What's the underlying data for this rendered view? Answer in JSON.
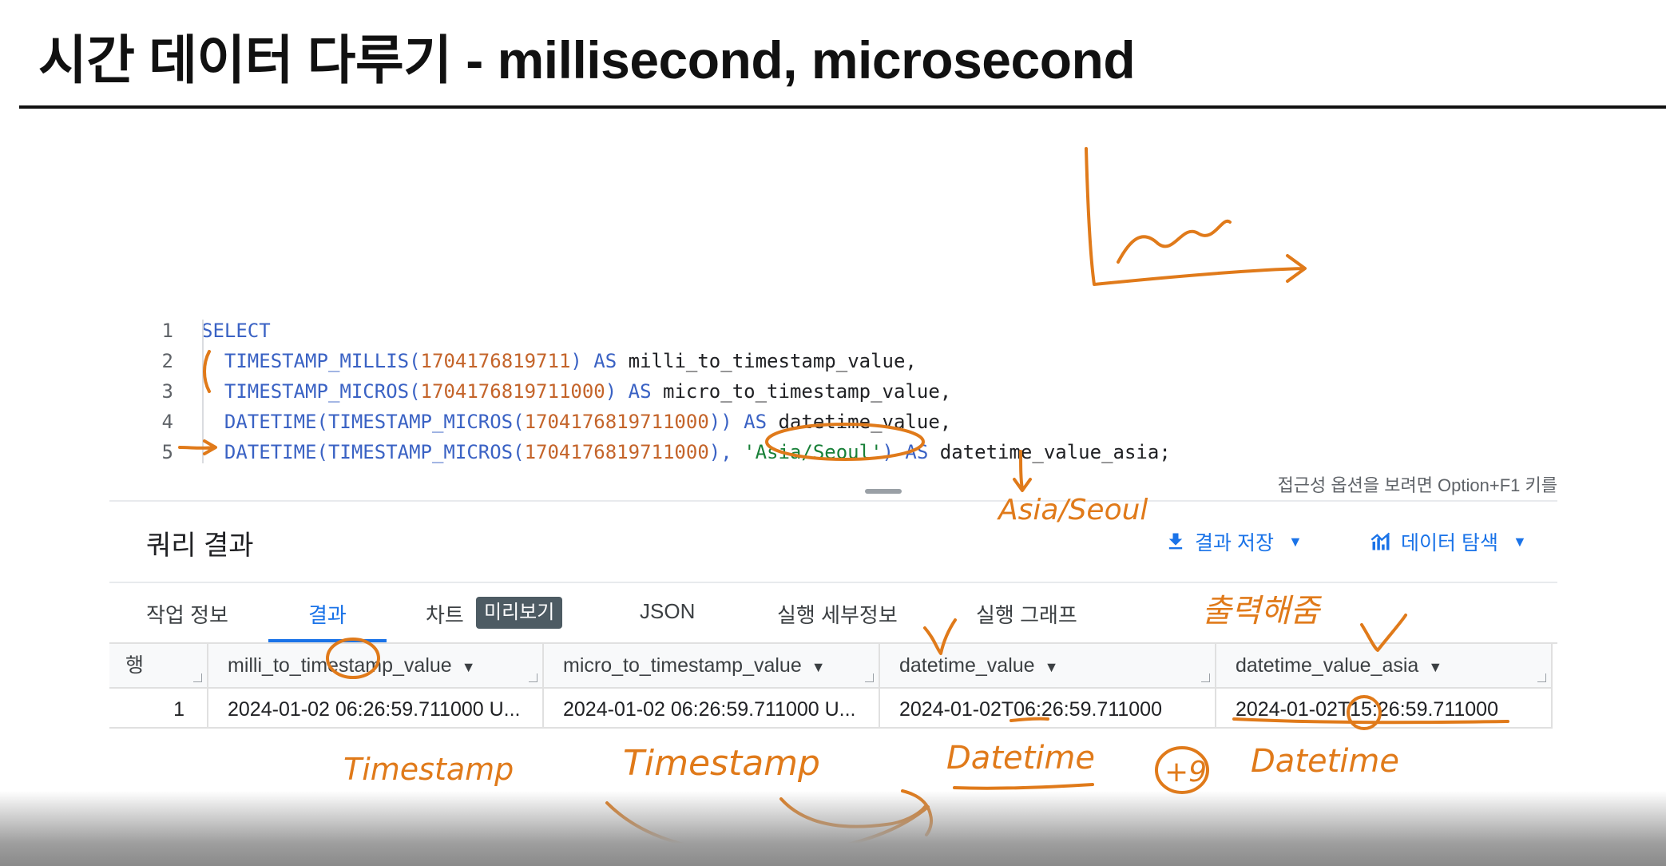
{
  "slide": {
    "title": "시간 데이터 다루기 - millisecond, microsecond"
  },
  "editor": {
    "lines": [
      {
        "num": "1",
        "tokens": [
          {
            "t": "SELECT",
            "c": "kw"
          }
        ]
      },
      {
        "num": "2",
        "tokens": [
          {
            "t": "  TIMESTAMP_MILLIS(",
            "c": "kw"
          },
          {
            "t": "1704176819711",
            "c": "num"
          },
          {
            "t": ") ",
            "c": "kw"
          },
          {
            "t": "AS",
            "c": "kw"
          },
          {
            "t": " milli_to_timestamp_value,",
            "c": "id"
          }
        ]
      },
      {
        "num": "3",
        "tokens": [
          {
            "t": "  TIMESTAMP_MICROS(",
            "c": "kw"
          },
          {
            "t": "1704176819711000",
            "c": "num"
          },
          {
            "t": ") ",
            "c": "kw"
          },
          {
            "t": "AS",
            "c": "kw"
          },
          {
            "t": " micro_to_timestamp_value,",
            "c": "id"
          }
        ]
      },
      {
        "num": "4",
        "tokens": [
          {
            "t": "  DATETIME(TIMESTAMP_MICROS(",
            "c": "kw"
          },
          {
            "t": "1704176819711000",
            "c": "num"
          },
          {
            "t": ")) ",
            "c": "kw"
          },
          {
            "t": "AS",
            "c": "kw"
          },
          {
            "t": " datetime_value,",
            "c": "id"
          }
        ]
      },
      {
        "num": "5",
        "tokens": [
          {
            "t": "  DATETIME(TIMESTAMP_MICROS(",
            "c": "kw"
          },
          {
            "t": "1704176819711000",
            "c": "num"
          },
          {
            "t": "), ",
            "c": "kw"
          },
          {
            "t": "'Asia/Seoul'",
            "c": "str"
          },
          {
            "t": ") ",
            "c": "kw"
          },
          {
            "t": "AS",
            "c": "kw"
          },
          {
            "t": " datetime_value_asia;",
            "c": "id"
          }
        ]
      }
    ],
    "a11y_hint": "접근성 옵션을 보려면 Option+F1 키를"
  },
  "results": {
    "title": "쿼리 결과",
    "save_label": "결과 저장",
    "explore_label": "데이터 탐색"
  },
  "tabs": {
    "job_info": "작업 정보",
    "results": "결과",
    "chart": "차트",
    "preview_badge": "미리보기",
    "json": "JSON",
    "exec_details": "실행 세부정보",
    "exec_graph": "실행 그래프"
  },
  "table": {
    "row_header": "행",
    "columns": [
      "milli_to_timestamp_value",
      "micro_to_timestamp_value",
      "datetime_value",
      "datetime_value_asia"
    ],
    "rows": [
      {
        "num": "1",
        "cells": [
          "2024-01-02 06:26:59.711000 U...",
          "2024-01-02 06:26:59.711000 U...",
          "2024-01-02T06:26:59.711000",
          "2024-01-02T15:26:59.711000"
        ]
      }
    ]
  },
  "annotations": {
    "asia_seoul": "Asia/Seoul",
    "korean_note": "출력해줌",
    "timestamp_1": "Timestamp",
    "timestamp_2": "Timestamp",
    "datetime_1": "Datetime",
    "datetime_2": "Datetime",
    "plus9": "+9"
  },
  "colors": {
    "accent": "#1a73e8",
    "keyword": "#3a62c4",
    "number": "#c4642a",
    "string": "#188038",
    "ink": "#e07a1a"
  }
}
